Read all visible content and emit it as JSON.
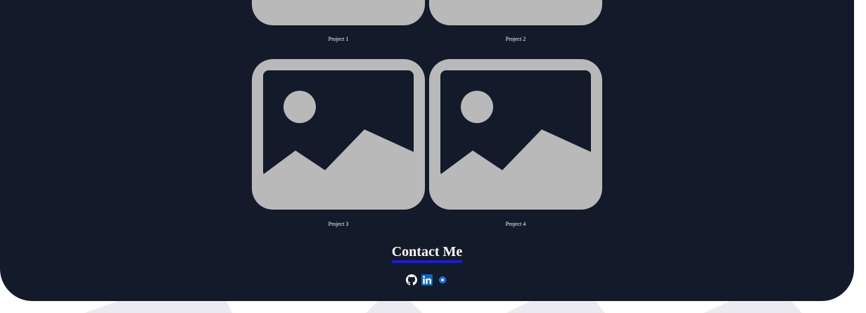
{
  "projects": [
    {
      "caption": "Project 1"
    },
    {
      "caption": "Project 2"
    },
    {
      "caption": "Project 3"
    },
    {
      "caption": "Project 4"
    }
  ],
  "contact": {
    "title": "Contact Me",
    "links": [
      {
        "icon": "github-icon"
      },
      {
        "icon": "linkedin-icon"
      },
      {
        "icon": "email-icon"
      }
    ]
  },
  "colors": {
    "panel": "#131a2a",
    "placeholder": "#b9b9b9",
    "underline": "#1a1ae6",
    "linkedin": "#0a66c2"
  }
}
